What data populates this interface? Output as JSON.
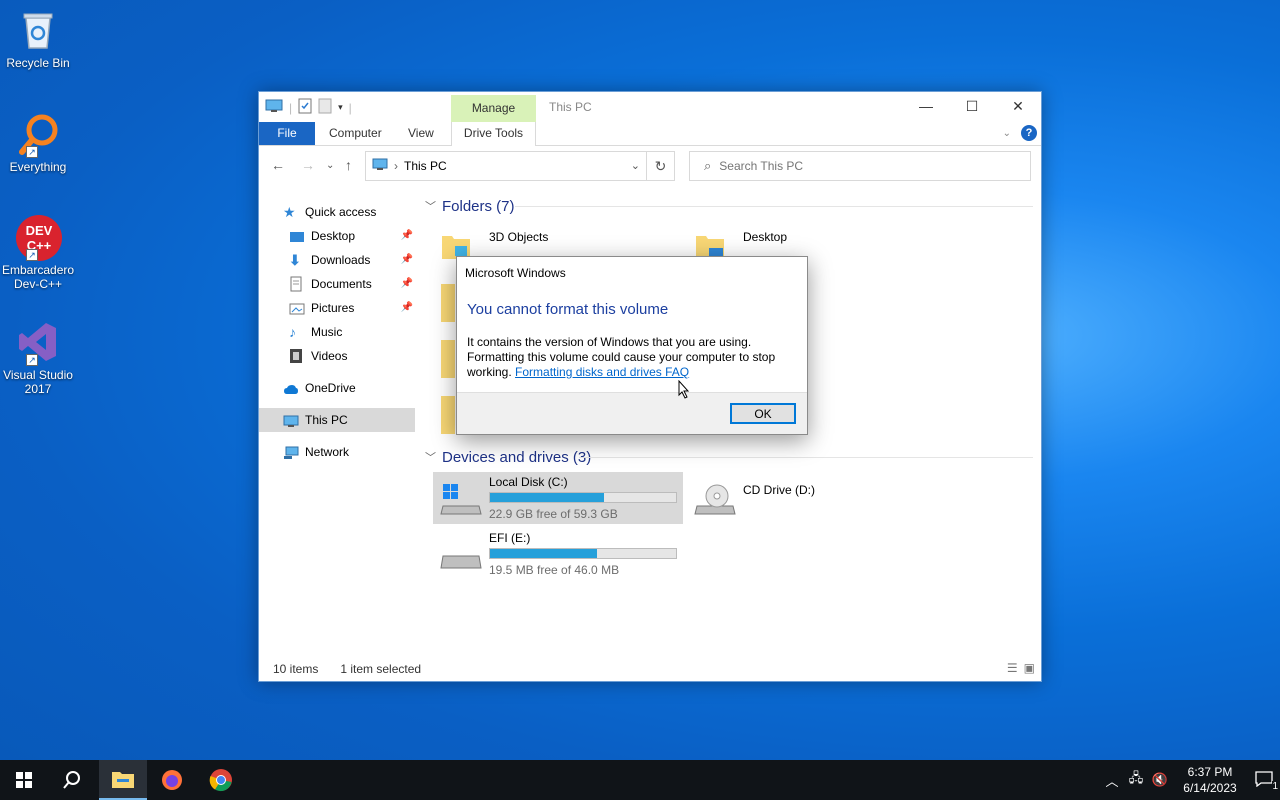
{
  "desktop": {
    "icons": [
      {
        "label": "Recycle Bin"
      },
      {
        "label": "Everything"
      },
      {
        "label": "Embarcadero Dev-C++",
        "logo_text": "DEV C++"
      },
      {
        "label": "Visual Studio 2017"
      }
    ]
  },
  "explorer": {
    "title": "This PC",
    "manage_tab": "Manage",
    "ribbon_tabs": {
      "file": "File",
      "computer": "Computer",
      "view": "View",
      "drive_tools": "Drive Tools"
    },
    "help": "?",
    "address": {
      "path": "This PC"
    },
    "search": {
      "placeholder": "Search This PC"
    },
    "nav": {
      "quick_access": "Quick access",
      "desktop": "Desktop",
      "downloads": "Downloads",
      "documents": "Documents",
      "pictures": "Pictures",
      "music": "Music",
      "videos": "Videos",
      "onedrive": "OneDrive",
      "this_pc": "This PC",
      "network": "Network"
    },
    "folders_header": "Folders (7)",
    "folders": [
      {
        "label": "3D Objects"
      },
      {
        "label": "Desktop"
      }
    ],
    "devices_header": "Devices and drives (3)",
    "drives": [
      {
        "label": "Local Disk (C:)",
        "free": "22.9 GB free of 59.3 GB",
        "used_fraction": 0.614
      },
      {
        "label": "CD Drive (D:)"
      },
      {
        "label": "EFI (E:)",
        "free": "19.5 MB free of 46.0 MB",
        "used_fraction": 0.576
      }
    ],
    "status": {
      "items": "10 items",
      "selected": "1 item selected"
    }
  },
  "dialog": {
    "title": "Microsoft Windows",
    "heading": "You cannot format this volume",
    "body": "It contains the version of Windows that you are using. Formatting this volume could cause your computer to stop working.",
    "link": "Formatting disks and drives FAQ",
    "ok": "OK"
  },
  "taskbar": {
    "time": "6:37 PM",
    "date": "6/14/2023",
    "notifications": "1"
  },
  "colors": {
    "accent": "#1a66c4",
    "drive_bar": "#26a0da",
    "manage_tab": "#d9f2b8",
    "heading_blue": "#1e3287"
  }
}
